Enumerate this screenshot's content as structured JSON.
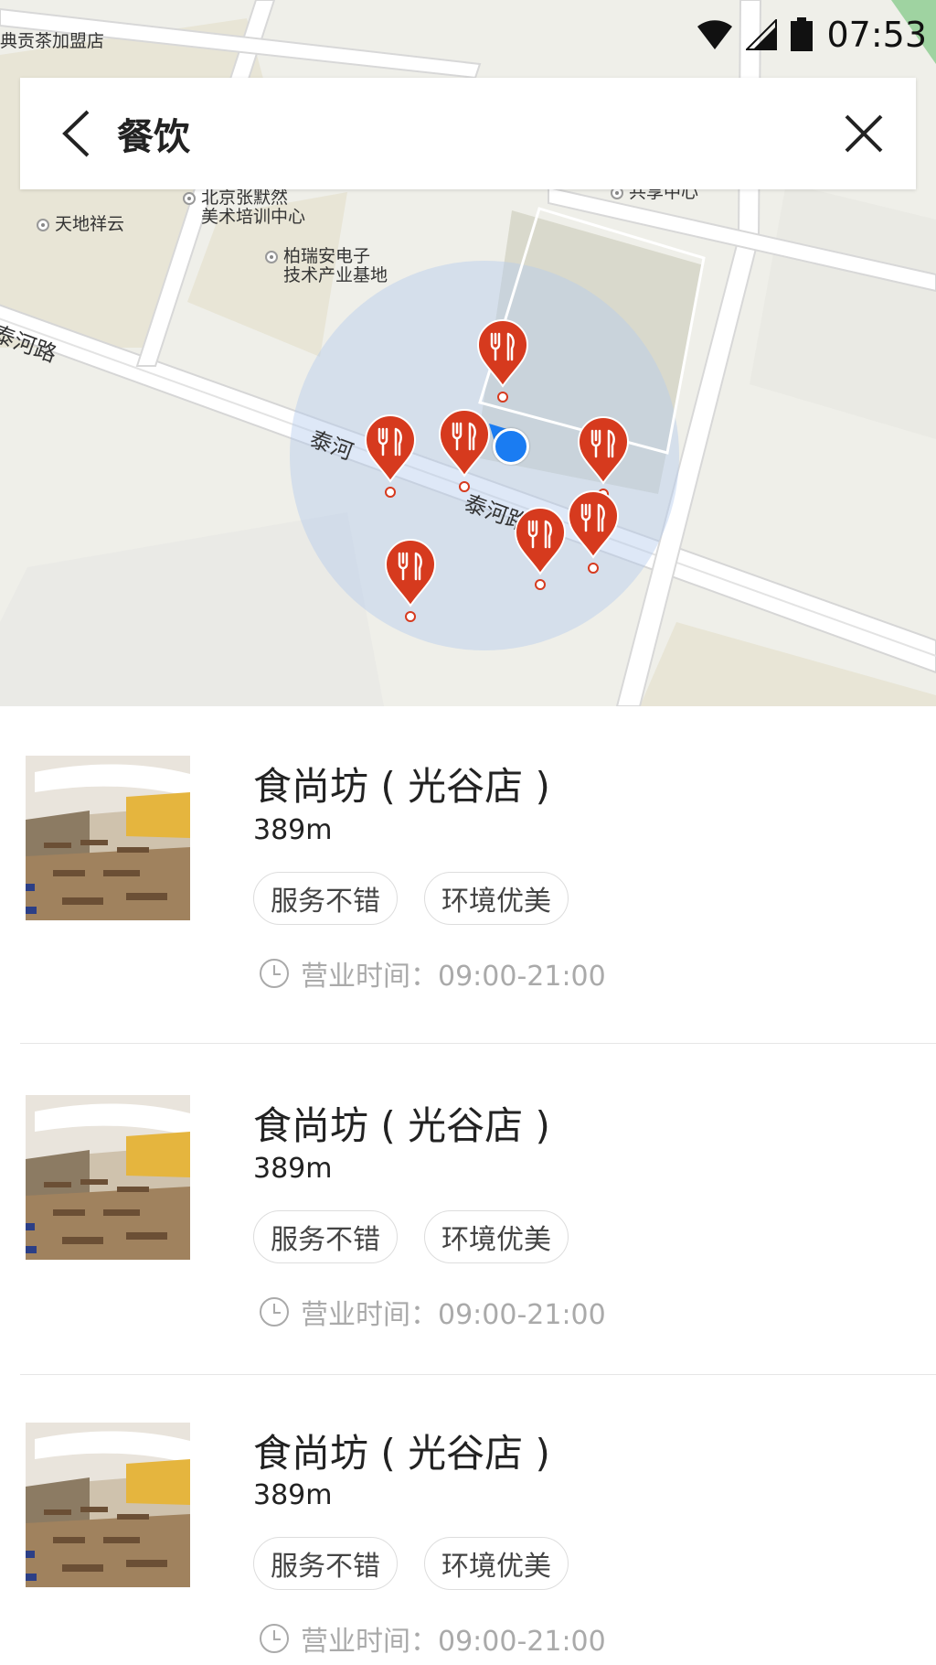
{
  "status_bar": {
    "time": "07:53"
  },
  "search": {
    "query": "餐饮"
  },
  "map": {
    "pois": [
      {
        "id": "p1",
        "line1": "典贡茶加盟店",
        "line2": ""
      },
      {
        "id": "p2",
        "line1": "北京张默然",
        "line2": "美术培训中心"
      },
      {
        "id": "p3",
        "line1": "天地祥云",
        "line2": ""
      },
      {
        "id": "p4",
        "line1": "柏瑞安电子",
        "line2": "技术产业基地"
      },
      {
        "id": "p5",
        "line1": "共享中心",
        "line2": ""
      }
    ],
    "roads": [
      {
        "id": "r1",
        "label": "泰河路"
      },
      {
        "id": "r2",
        "label": "泰河"
      },
      {
        "id": "r3",
        "label": "泰河路"
      }
    ],
    "pin_icon": "fork-knife-icon",
    "accent_color": "#d63a1e",
    "location_color": "#1a7cf2"
  },
  "results": [
    {
      "name": "食尚坊 ( 光谷店 )",
      "distance": "389m",
      "tags": [
        "服务不错",
        "环境优美"
      ],
      "hours": "营业时间：09:00-21:00"
    },
    {
      "name": "食尚坊 ( 光谷店 )",
      "distance": "389m",
      "tags": [
        "服务不错",
        "环境优美"
      ],
      "hours": "营业时间：09:00-21:00"
    },
    {
      "name": "食尚坊 ( 光谷店 )",
      "distance": "389m",
      "tags": [
        "服务不错",
        "环境优美"
      ],
      "hours": "营业时间：09:00-21:00"
    }
  ]
}
